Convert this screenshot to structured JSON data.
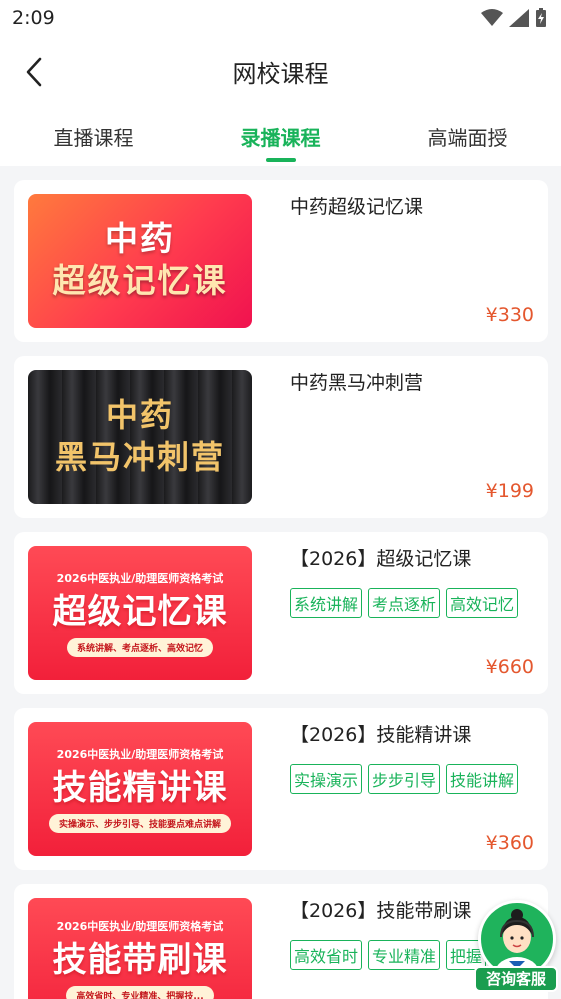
{
  "status": {
    "time": "2:09"
  },
  "header": {
    "title": "网校课程"
  },
  "tabs": [
    {
      "label": "直播课程",
      "active": false
    },
    {
      "label": "录播课程",
      "active": true
    },
    {
      "label": "高端面授",
      "active": false
    }
  ],
  "courses": [
    {
      "title": "中药超级记忆课",
      "price": "¥330",
      "tags": [],
      "thumb": {
        "line1": "中药",
        "line2": "超级记忆课"
      }
    },
    {
      "title": "中药黑马冲刺营",
      "price": "¥199",
      "tags": [],
      "thumb": {
        "line1": "中药",
        "line2": "黑马冲刺营"
      }
    },
    {
      "title": "【2026】超级记忆课",
      "price": "¥660",
      "tags": [
        "系统讲解",
        "考点逐析",
        "高效记忆"
      ],
      "thumb": {
        "top": "2026中医执业/助理医师资格考试",
        "main": "超级记忆课",
        "pill": "系统讲解、考点逐析、高效记忆"
      }
    },
    {
      "title": "【2026】技能精讲课",
      "price": "¥360",
      "tags": [
        "实操演示",
        "步步引导",
        "技能讲解"
      ],
      "thumb": {
        "top": "2026中医执业/助理医师资格考试",
        "main": "技能精讲课",
        "pill": "实操演示、步步引导、技能要点难点讲解"
      }
    },
    {
      "title": "【2026】技能带刷课",
      "price": "",
      "tags": [
        "高效省时",
        "专业精准",
        "把握"
      ],
      "thumb": {
        "top": "2026中医执业/助理医师资格考试",
        "main": "技能带刷课",
        "pill": "高效省时、专业精准、把握技..."
      }
    }
  ],
  "customer_service": {
    "label": "咨询客服"
  },
  "colors": {
    "accent": "#19b35a",
    "price": "#e4572e",
    "background": "#f4f5f7"
  }
}
